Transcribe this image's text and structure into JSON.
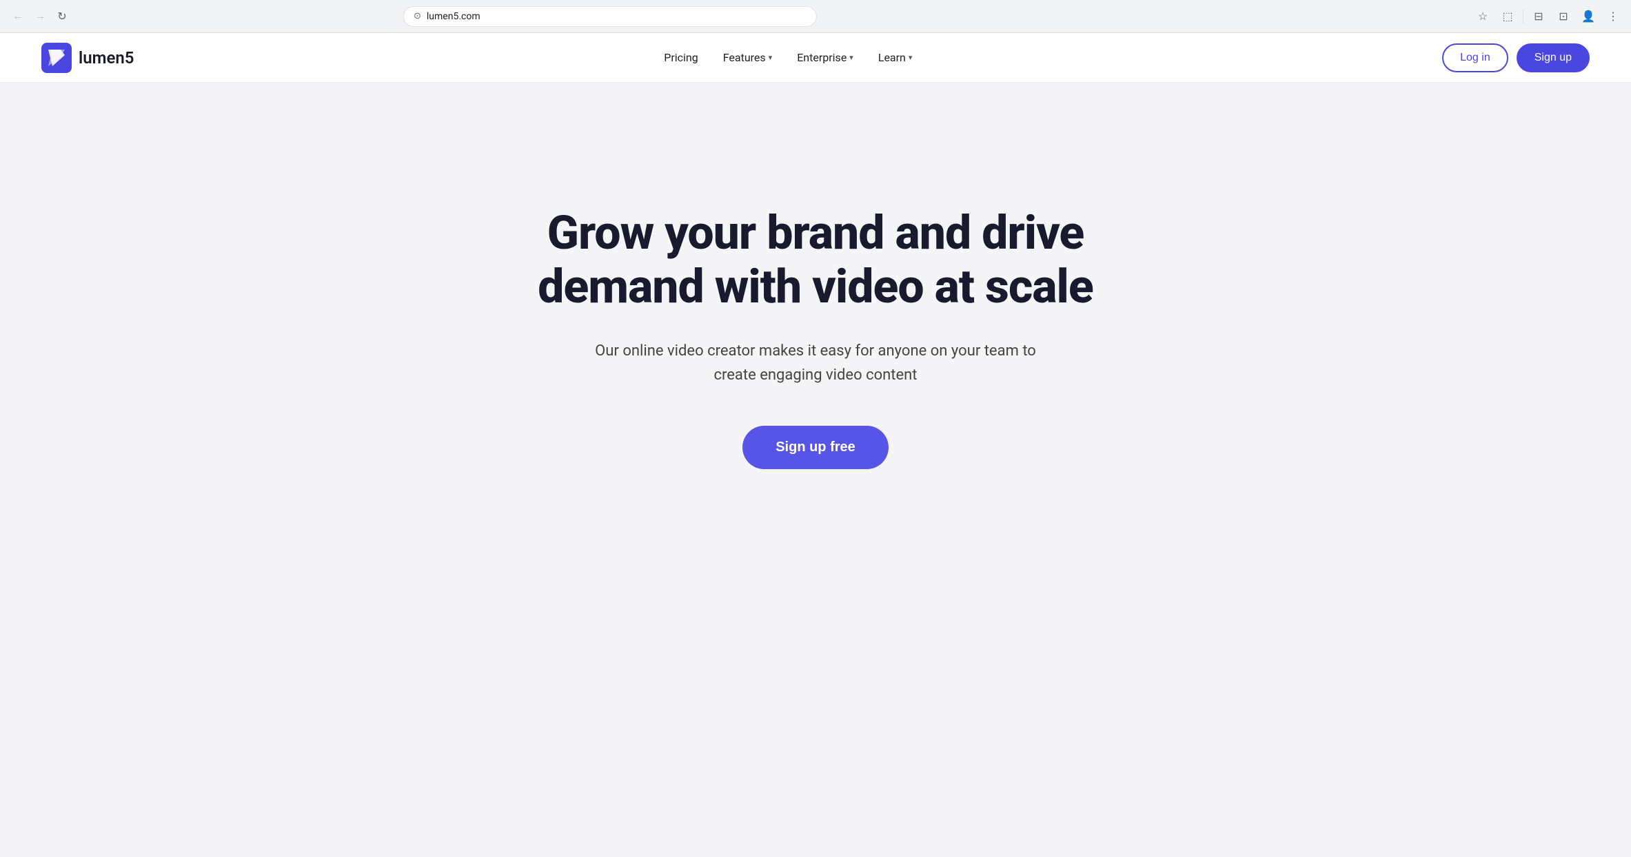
{
  "browser": {
    "back_btn": "←",
    "forward_btn": "→",
    "reload_btn": "↻",
    "url": "lumen5.com",
    "star_icon": "☆",
    "extension_icon": "⬚",
    "media_icon": "⊟",
    "sidebar_icon": "⊡",
    "profile_icon": "👤",
    "menu_icon": "⋮"
  },
  "navbar": {
    "logo_text": "lumen5",
    "nav_links": [
      {
        "label": "Pricing",
        "has_dropdown": false
      },
      {
        "label": "Features",
        "has_dropdown": true
      },
      {
        "label": "Enterprise",
        "has_dropdown": true
      },
      {
        "label": "Learn",
        "has_dropdown": true
      }
    ],
    "login_label": "Log in",
    "signup_label": "Sign up"
  },
  "hero": {
    "title": "Grow your brand and drive demand with video at scale",
    "subtitle": "Our online video creator makes it easy for anyone on your team to create engaging video content",
    "cta_label": "Sign up free"
  },
  "colors": {
    "brand_purple": "#4a47e0",
    "cta_purple": "#5754e8",
    "background": "#f5f5f7",
    "text_dark": "#1a1a2e",
    "text_mid": "#444444"
  }
}
